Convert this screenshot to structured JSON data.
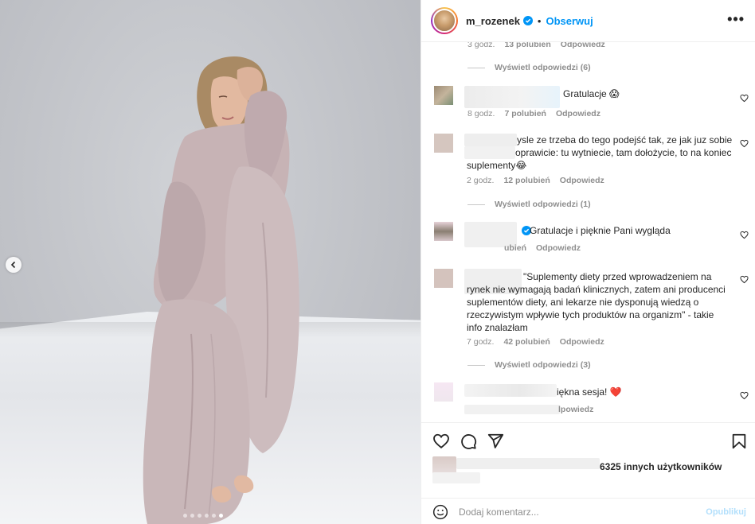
{
  "post": {
    "username": "m_rozenek",
    "separator": "•",
    "follow_label": "Obserwuj",
    "more_label": "•••",
    "carousel": {
      "dot_count": 6,
      "active_index": 5
    }
  },
  "comments": {
    "first_meta": {
      "time": "3 godz.",
      "likes": "13 polubień",
      "reply": "Odpowiedz"
    },
    "first_replies": "Wyświetl odpowiedzi (6)",
    "c1": {
      "text": "Gratulacje 😱",
      "time": "8 godz.",
      "likes": "7 polubień",
      "reply": "Odpowiedz"
    },
    "c2": {
      "line1": "ysle ze trzeba do tego podejść tak, ze jak juz sobie",
      "line2": "oprawicie: tu wytniecie, tam dołożycie, to na koniec",
      "line3": "suplementy😂",
      "time": "2 godz.",
      "likes": "12 polubień",
      "reply": "Odpowiedz",
      "replies": "Wyświetl odpowiedzi (1)"
    },
    "c3": {
      "text": "Gratulacje i pięknie Pani wygląda",
      "likes": "ubień",
      "reply": "Odpowiedz"
    },
    "c4": {
      "line1": "\"Suplementy diety przed wprowadzeniem na",
      "line2": "rynek nie wymagają badań klinicznych, zatem ani producenci",
      "line3": "suplementów diety, ani lekarze nie dysponują wiedzą o",
      "line4": "rzeczywistym wpływie tych produktów na organizm\" - takie",
      "line5": "info znalazłam",
      "time": "7 godz.",
      "likes": "42 polubień",
      "reply": "Odpowiedz",
      "replies": "Wyświetl odpowiedzi (3)"
    },
    "c5": {
      "text": "iękna sesja! ❤️",
      "reply": "lpowiedz"
    }
  },
  "likes_summary": {
    "text": "6325 innych użytkowników"
  },
  "composer": {
    "placeholder": "Dodaj komentarz...",
    "publish_label": "Opublikuj"
  },
  "colors": {
    "accent": "#0095f6",
    "text": "#262626",
    "muted": "#8e8e8e",
    "publish_disabled": "#b2dffc",
    "heart_red": "#ed4956"
  },
  "icons": [
    "chevron-left-icon",
    "verified-icon",
    "heart-icon",
    "comment-icon",
    "share-icon",
    "bookmark-icon",
    "emoji-icon"
  ]
}
